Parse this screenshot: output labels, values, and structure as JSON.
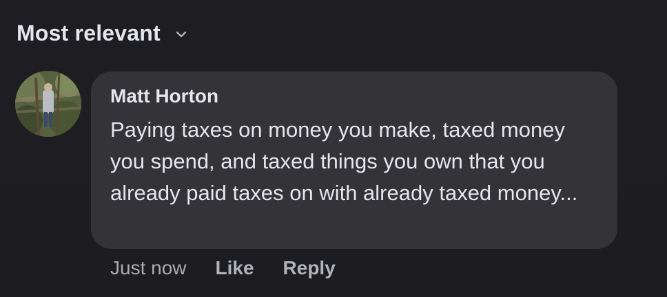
{
  "sort": {
    "label": "Most relevant",
    "icon": "chevron-down-icon"
  },
  "comment": {
    "author": "Matt Horton",
    "text": "Paying taxes on money you make, taxed money you spend, and taxed things you own that you already paid taxes on with already taxed money...",
    "timestamp": "Just now",
    "like_label": "Like",
    "reply_label": "Reply"
  },
  "colors": {
    "background": "#1c1c1f",
    "bubble": "#333338",
    "text_primary": "#e4e6eb",
    "text_secondary": "#b0b3b8"
  }
}
